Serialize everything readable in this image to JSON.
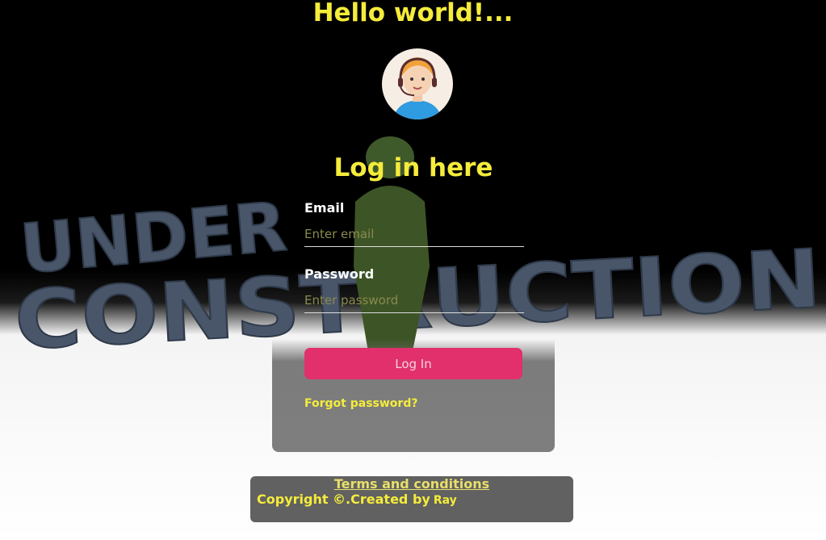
{
  "header": {
    "greeting": "Hello world!..."
  },
  "avatar": {
    "icon": "support-agent-avatar-icon"
  },
  "login": {
    "title": "Log in here",
    "email_label": "Email",
    "email_placeholder": "Enter email",
    "email_value": "",
    "password_label": "Password",
    "password_placeholder": "Enter password",
    "password_value": "",
    "submit_label": "Log In",
    "forgot_label": "Forgot password?"
  },
  "footer": {
    "terms_label": "Terms and conditions",
    "copyright_text": "Copyright ©.Created by",
    "author": "Ray"
  },
  "background": {
    "headline_line1": "UNDER",
    "headline_line2": "CONSTRUCTION"
  },
  "colors": {
    "accent_yellow": "#f5ec3b",
    "button_pink": "#e1306c",
    "footer_bg": "#616161"
  }
}
